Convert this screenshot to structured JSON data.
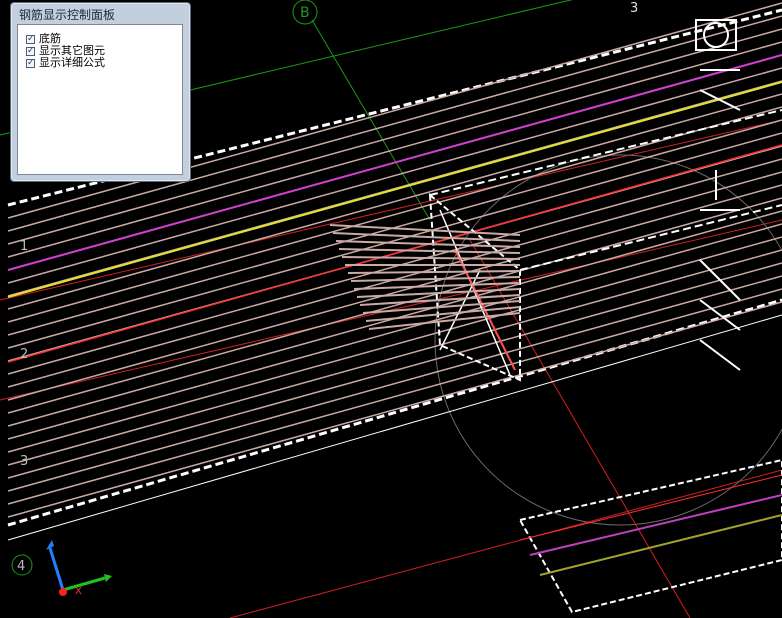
{
  "panel": {
    "title": "钢筋显示控制面板",
    "options": [
      {
        "label": "底筋",
        "checked": true
      },
      {
        "label": "显示其它图元",
        "checked": true
      },
      {
        "label": "显示详细公式",
        "checked": true
      }
    ]
  },
  "axis_labels": {
    "b": "B",
    "three": "3",
    "one": "1",
    "two": "2",
    "row3": "3",
    "four": "4"
  },
  "ucs_icon": {
    "x_label": "X"
  },
  "colors": {
    "background": "#000000",
    "rebar": "#c9aaa4",
    "slab_edge": "#ffffff",
    "axis_red": "#ff2020",
    "axis_green": "#1a9a1a",
    "magenta": "#d040d0",
    "yellow": "#e0e030"
  }
}
